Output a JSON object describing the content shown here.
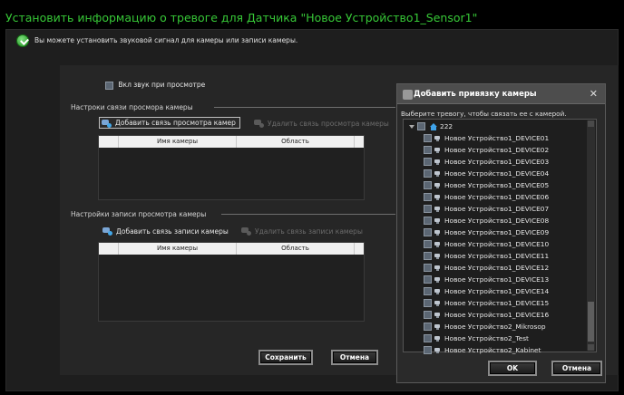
{
  "title": "Установить информацию о тревоге для Датчика \"Новое Устройство1_Sensor1\"",
  "info_text": "Вы можете установить звуковой сигнал для камеры или записи камеры.",
  "sound_checkbox_label": "Вкл звук при просмотре",
  "view_section": {
    "title": "Настроки связи просмора камеры",
    "add_label": "Добавить связь просмотра камер",
    "remove_label": "Удалить связь просмотра камеры",
    "columns": [
      "Имя камеры",
      "Область"
    ]
  },
  "record_section": {
    "title": "Настройки записи просмотра камеры",
    "add_label": "Добавить связь записи камеры",
    "remove_label": "Удалить связь записи камеры",
    "columns": [
      "Имя камеры",
      "Область"
    ]
  },
  "buttons": {
    "save": "Сохранить",
    "cancel": "Отмена"
  },
  "dialog": {
    "title": "Добавить привязку камеры",
    "hint": "Выберите тревогу, чтобы связать ее с камерой.",
    "root": "222",
    "devices": [
      "Новое Устройство1_DEVICE01",
      "Новое Устройство1_DEVICE02",
      "Новое Устройство1_DEVICE03",
      "Новое Устройство1_DEVICE04",
      "Новое Устройство1_DEVICE05",
      "Новое Устройство1_DEVICE06",
      "Новое Устройство1_DEVICE07",
      "Новое Устройство1_DEVICE08",
      "Новое Устройство1_DEVICE09",
      "Новое Устройство1_DEVICE10",
      "Новое Устройство1_DEVICE11",
      "Новое Устройство1_DEVICE12",
      "Новое Устройство1_DEVICE13",
      "Новое Устройство1_DEVICE14",
      "Новое Устройство1_DEVICE15",
      "Новое Устройство1_DEVICE16",
      "Новое Устройство2_Mikrosop",
      "Новое Устройство2_Test",
      "Новое Устройство2_Kabinet"
    ],
    "ok": "OK",
    "cancel": "Отмена"
  }
}
